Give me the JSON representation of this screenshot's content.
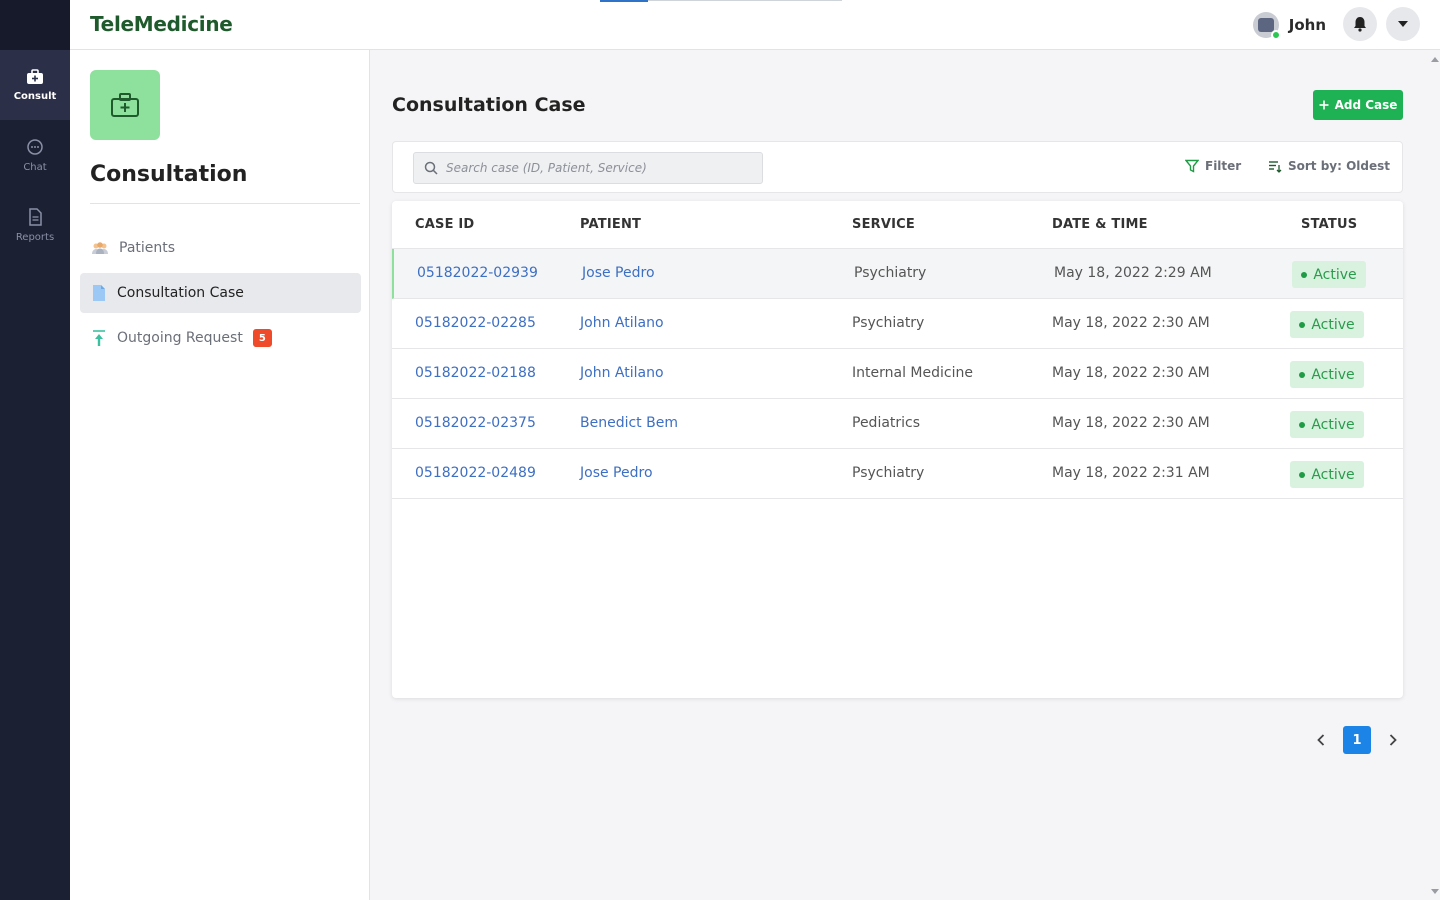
{
  "app": {
    "brand": "TeleMedicine"
  },
  "header": {
    "user_name": "John"
  },
  "rail": {
    "items": [
      {
        "label": "Consult",
        "icon": "medkit-icon",
        "active": true
      },
      {
        "label": "Chat",
        "icon": "chat-bubble-icon",
        "active": false
      },
      {
        "label": "Reports",
        "icon": "document-icon",
        "active": false
      }
    ]
  },
  "subnav": {
    "title": "Consultation",
    "items": [
      {
        "label": "Patients",
        "icon": "people-icon"
      },
      {
        "label": "Consultation Case",
        "icon": "file-icon",
        "active": true
      },
      {
        "label": "Outgoing Request",
        "icon": "upload-arrow-icon",
        "badge": "5"
      }
    ]
  },
  "main": {
    "title": "Consultation Case",
    "add_label": "Add Case",
    "search_placeholder": "Search case (ID, Patient, Service)",
    "filter_label": "Filter",
    "sort_label": "Sort by: Oldest"
  },
  "table": {
    "columns": [
      "CASE ID",
      "PATIENT",
      "SERVICE",
      "DATE & TIME",
      "STATUS"
    ],
    "rows": [
      {
        "id": "05182022-02939",
        "patient": "Jose Pedro",
        "service": "Psychiatry",
        "datetime": "May 18, 2022 2:29 AM",
        "status": "Active"
      },
      {
        "id": "05182022-02285",
        "patient": "John Atilano",
        "service": "Psychiatry",
        "datetime": "May 18, 2022 2:30 AM",
        "status": "Active"
      },
      {
        "id": "05182022-02188",
        "patient": "John Atilano",
        "service": "Internal Medicine",
        "datetime": "May 18, 2022 2:30 AM",
        "status": "Active"
      },
      {
        "id": "05182022-02375",
        "patient": "Benedict Bem",
        "service": "Pediatrics",
        "datetime": "May 18, 2022 2:30 AM",
        "status": "Active"
      },
      {
        "id": "05182022-02489",
        "patient": "Jose Pedro",
        "service": "Psychiatry",
        "datetime": "May 18, 2022 2:31 AM",
        "status": "Active"
      }
    ]
  },
  "pagination": {
    "current": "1"
  },
  "colors": {
    "brand": "#1f5a2c",
    "accent_green": "#1fb254",
    "link_blue": "#3d6fc2",
    "rail_bg": "#1c2033",
    "page_blue": "#1b84e6",
    "badge_red": "#ef4a2a"
  }
}
